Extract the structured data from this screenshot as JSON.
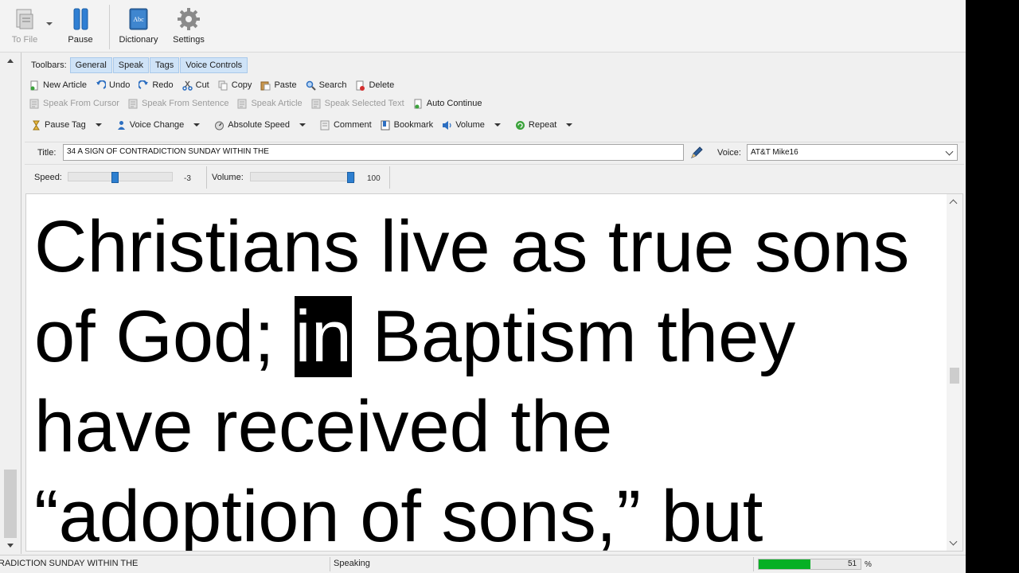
{
  "ribbon": {
    "to_file": "To File",
    "pause": "Pause",
    "dictionary": "Dictionary",
    "dictionary_icon_text": "Abc",
    "settings": "Settings"
  },
  "toolbars": {
    "label": "Toolbars:",
    "tabs": [
      "General",
      "Speak",
      "Tags",
      "Voice Controls"
    ]
  },
  "general_tools": {
    "new_article": "New Article",
    "undo": "Undo",
    "redo": "Redo",
    "cut": "Cut",
    "copy": "Copy",
    "paste": "Paste",
    "search": "Search",
    "delete": "Delete"
  },
  "speak_tools": {
    "speak_from_cursor": "Speak From Cursor",
    "speak_from_sentence": "Speak From Sentence",
    "speak_article": "Speak Article",
    "speak_selected_text": "Speak Selected Text",
    "auto_continue": "Auto Continue"
  },
  "tag_tools": {
    "pause_tag": "Pause Tag",
    "voice_change": "Voice Change",
    "absolute_speed": "Absolute Speed",
    "comment": "Comment",
    "bookmark": "Bookmark",
    "volume": "Volume",
    "repeat": "Repeat"
  },
  "title_row": {
    "title_label": "Title:",
    "title_value": "34 A SIGN OF CONTRADICTION SUNDAY WITHIN THE",
    "voice_label": "Voice:",
    "voice_value": "AT&T Mike16"
  },
  "voice_controls": {
    "speed_label": "Speed:",
    "speed_value": "-3",
    "speed_level": 0.45,
    "volume_label": "Volume:",
    "volume_value": "100",
    "volume_level": 1.0
  },
  "reader": {
    "before_highlight": "Christians live as true sons of God; ",
    "highlighted_word": "in",
    "after_highlight": " Baptism they have received the “adoption of sons,” but"
  },
  "status": {
    "article_title": "RADICTION SUNDAY WITHIN THE",
    "state": "Speaking",
    "progress_value": "51",
    "progress_fraction": 0.51,
    "percent_sign": "%"
  },
  "colors": {
    "tab_active_bg": "#cfe3f7",
    "slider_knob": "#2d7fd0",
    "progress_fill": "#06b025",
    "highlight_bg": "#000000"
  }
}
